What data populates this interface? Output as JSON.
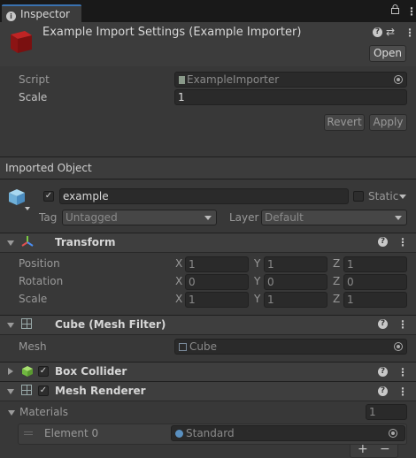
{
  "window": {
    "tab_title": "Inspector",
    "lock_icon": "lock-icon",
    "menu_icon": "kebab-menu-icon"
  },
  "header": {
    "title": "Example Import Settings (Example Importer)",
    "open_label": "Open"
  },
  "importer": {
    "script_label": "Script",
    "script_value": "ExampleImporter",
    "scale_label": "Scale",
    "scale_value": "1",
    "revert_label": "Revert",
    "apply_label": "Apply"
  },
  "imported_object": {
    "section_label": "Imported Object",
    "name": "example",
    "static_label": "Static",
    "tag_label": "Tag",
    "tag_value": "Untagged",
    "layer_label": "Layer",
    "layer_value": "Default"
  },
  "transform": {
    "title": "Transform",
    "rows": [
      {
        "label": "Position",
        "x": "1",
        "y": "1",
        "z": "1"
      },
      {
        "label": "Rotation",
        "x": "0",
        "y": "0",
        "z": "0"
      },
      {
        "label": "Scale",
        "x": "1",
        "y": "1",
        "z": "1"
      }
    ],
    "axis_x": "X",
    "axis_y": "Y",
    "axis_z": "Z"
  },
  "mesh_filter": {
    "title": "Cube (Mesh Filter)",
    "mesh_label": "Mesh",
    "mesh_value": "Cube"
  },
  "box_collider": {
    "title": "Box Collider"
  },
  "mesh_renderer": {
    "title": "Mesh Renderer",
    "materials_label": "Materials",
    "materials_count": "1",
    "element_label": "Element 0",
    "element_value": "Standard",
    "add_label": "+",
    "remove_label": "−"
  },
  "colors": {
    "accent": "#3a72b0",
    "background": "#383838",
    "field": "#2a2a2a"
  }
}
